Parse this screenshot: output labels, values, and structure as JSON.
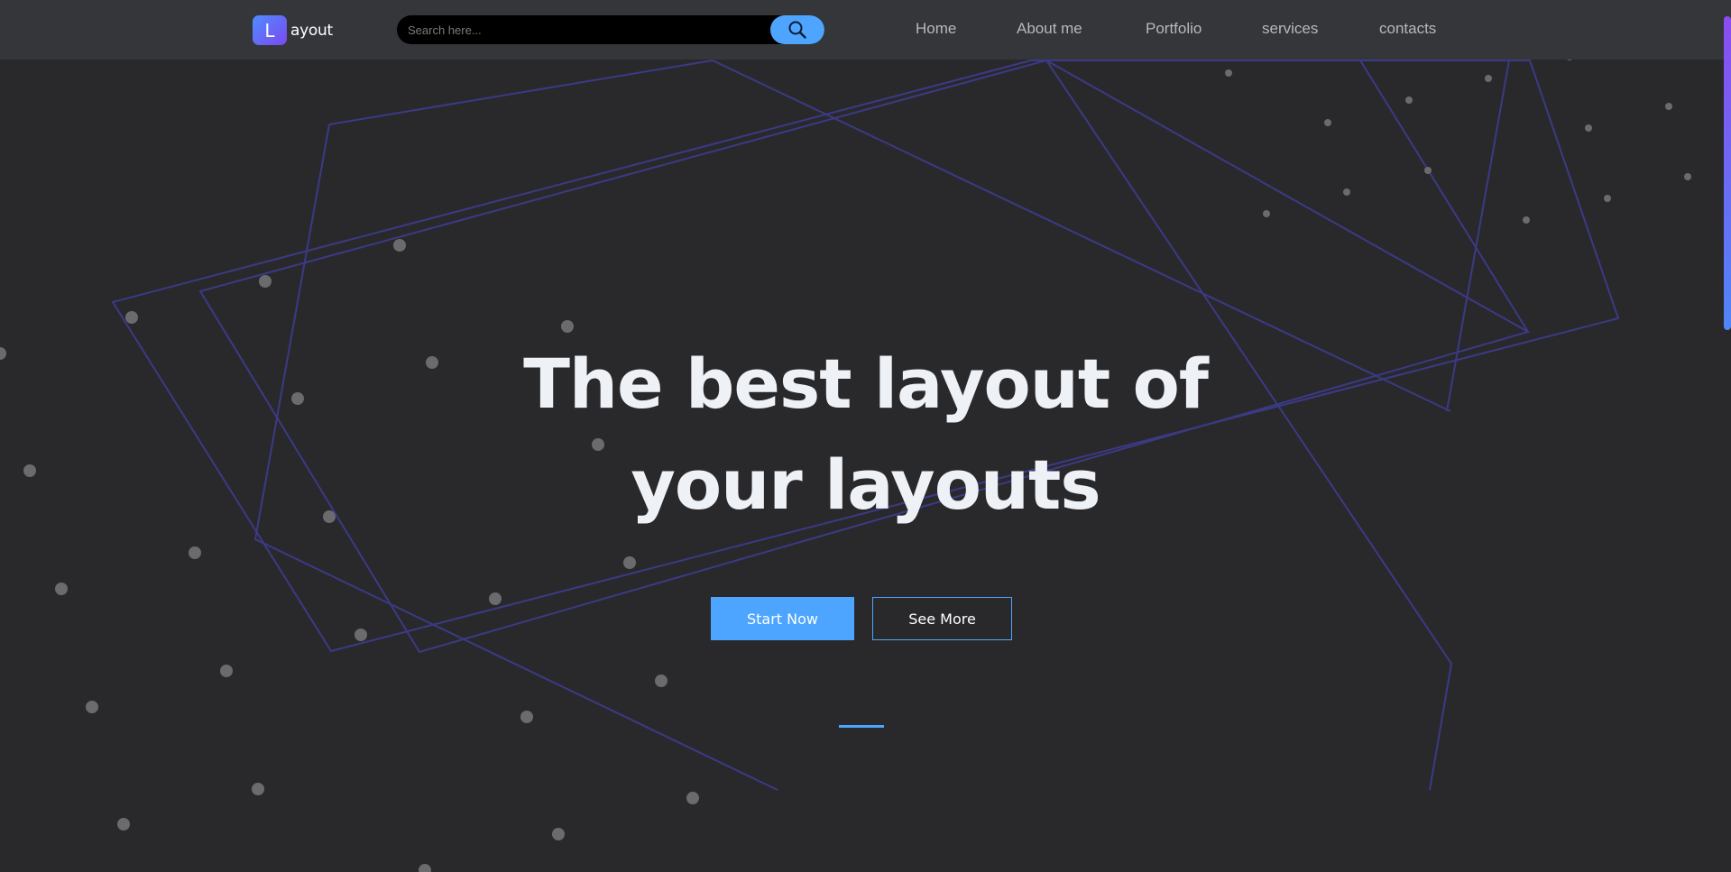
{
  "header": {
    "logo_letter": "L",
    "logo_text": "ayout",
    "search": {
      "placeholder": "Search here..."
    },
    "nav": [
      "Home",
      "About me",
      "Portfolio",
      "services",
      "contacts"
    ]
  },
  "hero": {
    "title_line1": "The best layout of",
    "title_line2": "your layouts",
    "primary_button": "Start Now",
    "secondary_button": "See More"
  },
  "colors": {
    "accent": "#4ea5ff",
    "background": "#29292c",
    "navbar": "#353639",
    "line_shapes": "#3b3a85",
    "particles": "#6b6b6e"
  },
  "icons": {
    "search": "search-icon"
  }
}
